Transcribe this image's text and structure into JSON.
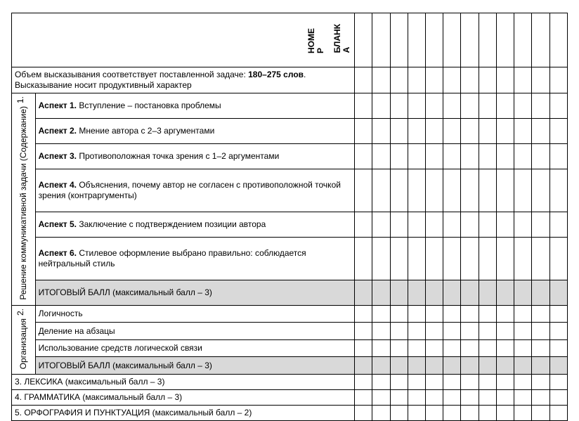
{
  "header": {
    "col_labels": [
      "НОМЕ",
      "Р",
      "БЛАНК",
      "А"
    ]
  },
  "volume_row": {
    "prefix": "Объем высказывания соответствует поставленной задаче: ",
    "bold_range": "180–275  слов",
    "suffix": ". Высказывание носит продуктивный характер"
  },
  "section1": {
    "number": "1.",
    "category": "Решение коммуникативной задачи (Содержание)",
    "rows": [
      {
        "label": "Аспект 1.",
        "text": "Вступление – постановка проблемы"
      },
      {
        "label": "Аспект 2.",
        "text": "Мнение автора с 2–3 аргументами"
      },
      {
        "label": "Аспект 3.",
        "text": "Противоположная точка зрения с 1–2 аргументами"
      },
      {
        "label": "Аспект 4.",
        "text": "Объяснения, почему автор не согласен с противоположной точкой зрения  (контраргументы)"
      },
      {
        "label": "Аспект 5.",
        "text": "Заключение с подтверждением позиции автора"
      },
      {
        "label": "Аспект 6.",
        "text": "Стилевое оформление выбрано правильно: соблюдается нейтральный стиль"
      }
    ],
    "total": "ИТОГОВЫЙ БАЛЛ  (максимальный балл – 3)"
  },
  "section2": {
    "number": "2.",
    "category": "Организация",
    "rows": [
      "Логичность",
      "Деление на абзацы",
      "Использование средств логической связи"
    ],
    "total": "ИТОГОВЫЙ БАЛЛ  (максимальный балл – 3)"
  },
  "plain_rows": [
    "3. ЛЕКСИКА  (максимальный балл – 3)",
    "4. ГРАММАТИКА (максимальный балл – 3)",
    "5. ОРФОГРАФИЯ И ПУНКТУАЦИЯ (максимальный балл – 2)"
  ],
  "score_columns": 12
}
